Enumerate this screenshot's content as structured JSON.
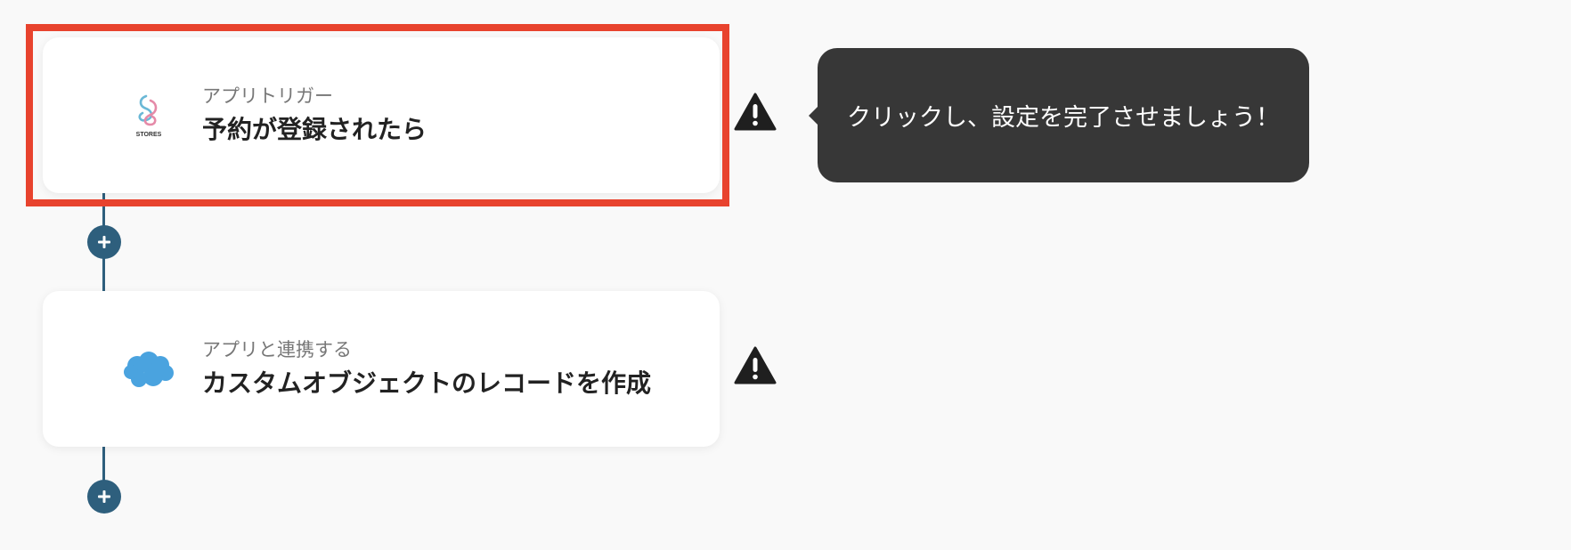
{
  "flow": {
    "steps": [
      {
        "icon": "stores-logo-icon",
        "icon_text": "STORES",
        "subtitle": "アプリトリガー",
        "title": "予約が登録されたら",
        "status_icon": "warning-icon",
        "highlighted": true
      },
      {
        "icon": "salesforce-cloud-icon",
        "subtitle": "アプリと連携する",
        "title": "カスタムオブジェクトのレコードを作成",
        "status_icon": "warning-icon",
        "highlighted": false
      }
    ],
    "add_button_icon": "plus-icon"
  },
  "tooltip": {
    "text": "クリックし、設定を完了させましょう！"
  },
  "colors": {
    "background": "#f9f9f9",
    "connector": "#2e5f7d",
    "highlight": "#e8432e",
    "tooltip_bg": "#373737",
    "warning": "#1f1f1f",
    "salesforce": "#4aa3df"
  }
}
